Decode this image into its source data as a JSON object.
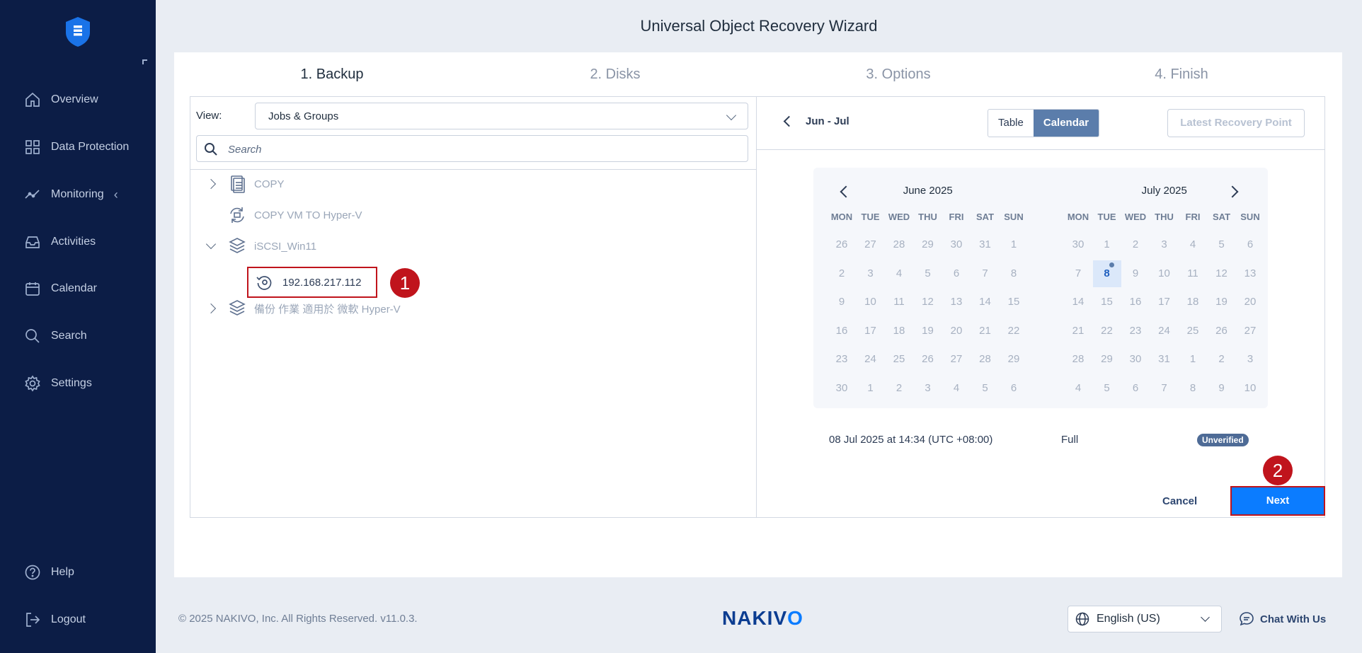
{
  "sidebar": {
    "items": [
      {
        "label": "Overview",
        "icon": "home-icon"
      },
      {
        "label": "Data Protection",
        "icon": "grid-icon"
      },
      {
        "label": "Monitoring",
        "icon": "chart-line-icon"
      },
      {
        "label": "Activities",
        "icon": "inbox-icon"
      },
      {
        "label": "Calendar",
        "icon": "calendar-icon"
      },
      {
        "label": "Search",
        "icon": "search-icon"
      },
      {
        "label": "Settings",
        "icon": "gear-icon"
      }
    ],
    "bottom": [
      {
        "label": "Help",
        "icon": "help-icon"
      },
      {
        "label": "Logout",
        "icon": "logout-icon"
      }
    ]
  },
  "wizard": {
    "title": "Universal Object Recovery Wizard",
    "steps": [
      "1. Backup",
      "2. Disks",
      "3. Options",
      "4. Finish"
    ]
  },
  "left": {
    "view_label": "View:",
    "view_value": "Jobs & Groups",
    "search_placeholder": "Search",
    "tree": [
      {
        "label": "COPY"
      },
      {
        "label": "COPY VM TO Hyper-V"
      },
      {
        "label": "iSCSI_Win11"
      },
      {
        "label": "192.168.217.112"
      },
      {
        "label": "備份 作業 適用於 微軟 Hyper-V"
      }
    ]
  },
  "right": {
    "period": "Jun - Jul",
    "toggle": [
      "Table",
      "Calendar"
    ],
    "latest": "Latest Recovery Point",
    "dow": [
      "MON",
      "TUE",
      "WED",
      "THU",
      "FRI",
      "SAT",
      "SUN"
    ],
    "months": [
      {
        "title": "June 2025",
        "days": [
          "26",
          "27",
          "28",
          "29",
          "30",
          "31",
          "1",
          "2",
          "3",
          "4",
          "5",
          "6",
          "7",
          "8",
          "9",
          "10",
          "11",
          "12",
          "13",
          "14",
          "15",
          "16",
          "17",
          "18",
          "19",
          "20",
          "21",
          "22",
          "23",
          "24",
          "25",
          "26",
          "27",
          "28",
          "29",
          "30",
          "1",
          "2",
          "3",
          "4",
          "5",
          "6"
        ]
      },
      {
        "title": "July 2025",
        "days": [
          "30",
          "1",
          "2",
          "3",
          "4",
          "5",
          "6",
          "7",
          "8",
          "9",
          "10",
          "11",
          "12",
          "13",
          "14",
          "15",
          "16",
          "17",
          "18",
          "19",
          "20",
          "21",
          "22",
          "23",
          "24",
          "25",
          "26",
          "27",
          "28",
          "29",
          "30",
          "31",
          "1",
          "2",
          "3",
          "4",
          "5",
          "6",
          "7",
          "8",
          "9",
          "10"
        ]
      }
    ],
    "selected": {
      "month": 1,
      "index": 8
    },
    "recovery_point": {
      "date": "08 Jul 2025 at 14:34 (UTC +08:00)",
      "type": "Full",
      "status": "Unverified"
    }
  },
  "annotations": [
    "1",
    "2"
  ],
  "actions": {
    "cancel": "Cancel",
    "next": "Next"
  },
  "footer": {
    "copyright": "© 2025 NAKIVO, Inc. All Rights Reserved. v11.0.3.",
    "brand": "NAKIVO",
    "language": "English (US)",
    "chat": "Chat With Us"
  },
  "colors": {
    "sidebar": "#0c1d46",
    "primary": "#0b7cff",
    "annotation": "#c0141c"
  }
}
